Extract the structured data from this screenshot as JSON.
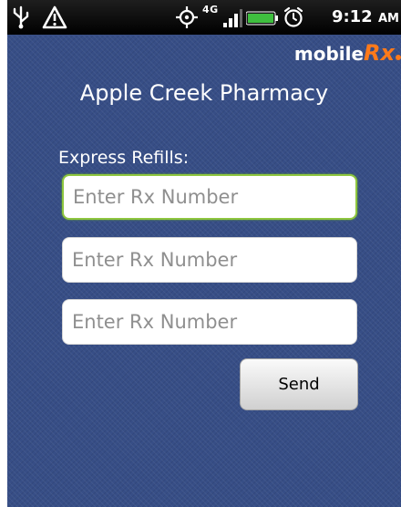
{
  "status_bar": {
    "time": "9:12",
    "ampm": "AM",
    "network": "4G",
    "icons": [
      "usb-icon",
      "warning-icon",
      "gps-icon",
      "network-4g-icon",
      "signal-icon",
      "battery-icon",
      "alarm-icon"
    ]
  },
  "brand": {
    "prefix": "mobile",
    "suffix": "Rx"
  },
  "pharmacy_name": "Apple Creek Pharmacy",
  "refills": {
    "label": "Express Refills:",
    "fields": [
      {
        "placeholder": "Enter Rx Number",
        "value": ""
      },
      {
        "placeholder": "Enter Rx Number",
        "value": ""
      },
      {
        "placeholder": "Enter Rx Number",
        "value": ""
      }
    ],
    "send_label": "Send"
  },
  "colors": {
    "background": "#374e86",
    "accent": "#ff7a1a",
    "focus": "#8ec63f"
  }
}
